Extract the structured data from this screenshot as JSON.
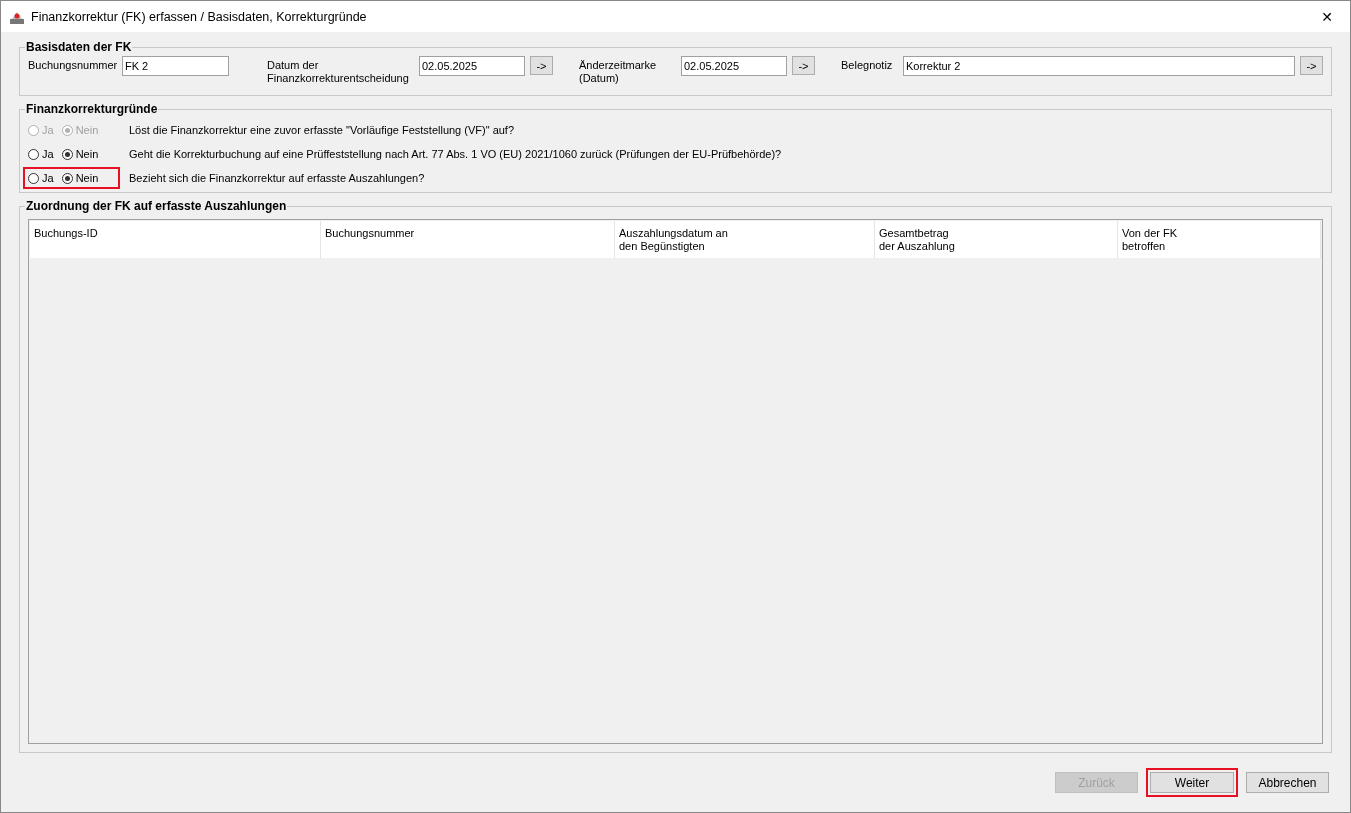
{
  "window": {
    "title": "Finanzkorrektur (FK) erfassen / Basisdaten, Korrekturgründe",
    "close": "✕"
  },
  "basisdaten": {
    "legend": "Basisdaten der FK",
    "fields": [
      {
        "kind": "text",
        "label": "Buchungsnummer",
        "value": "FK 2"
      },
      {
        "kind": "date",
        "label": "Datum der Finanzkorrekturentscheidung",
        "value": "02.05.2025",
        "button": "->"
      },
      {
        "kind": "date",
        "label": "Änderzeitmarke (Datum)",
        "value": "02.05.2025",
        "button": "->"
      },
      {
        "kind": "note",
        "label": "Belegnotiz",
        "value": "Korrektur 2",
        "button": "->"
      }
    ]
  },
  "gruende": {
    "legend": "Finanzkorrekturgründe",
    "questions": [
      {
        "text": "Löst die Finanzkorrektur eine zuvor erfasste \"Vorläufige Feststellung (VF)\" auf?",
        "disabled": true,
        "highlighted": false,
        "options": [
          {
            "label": "Ja",
            "selected": false
          },
          {
            "label": "Nein",
            "selected": true
          }
        ]
      },
      {
        "text": "Geht die Korrekturbuchung auf eine Prüffeststellung nach Art. 77 Abs. 1 VO (EU) 2021/1060 zurück (Prüfungen der EU-Prüfbehörde)?",
        "disabled": false,
        "highlighted": false,
        "options": [
          {
            "label": "Ja",
            "selected": false
          },
          {
            "label": "Nein",
            "selected": true
          }
        ]
      },
      {
        "text": "Bezieht sich die Finanzkorrektur auf erfasste Auszahlungen?",
        "disabled": false,
        "highlighted": true,
        "options": [
          {
            "label": "Ja",
            "selected": false
          },
          {
            "label": "Nein",
            "selected": true
          }
        ]
      }
    ]
  },
  "zuordnung": {
    "legend": "Zuordnung der FK auf erfasste Auszahlungen",
    "table": {
      "columns": [
        "Buchungs-ID",
        "Buchungsnummer",
        "Auszahlungsdatum an\nden Begünstigten",
        "Gesamtbetrag\nder Auszahlung",
        "Von der FK\nbetroffen"
      ]
    }
  },
  "buttons": [
    {
      "label": "Zurück",
      "disabled": true,
      "highlighted": false
    },
    {
      "label": "Weiter",
      "disabled": false,
      "highlighted": true
    },
    {
      "label": "Abbrechen",
      "disabled": false,
      "highlighted": false
    }
  ]
}
